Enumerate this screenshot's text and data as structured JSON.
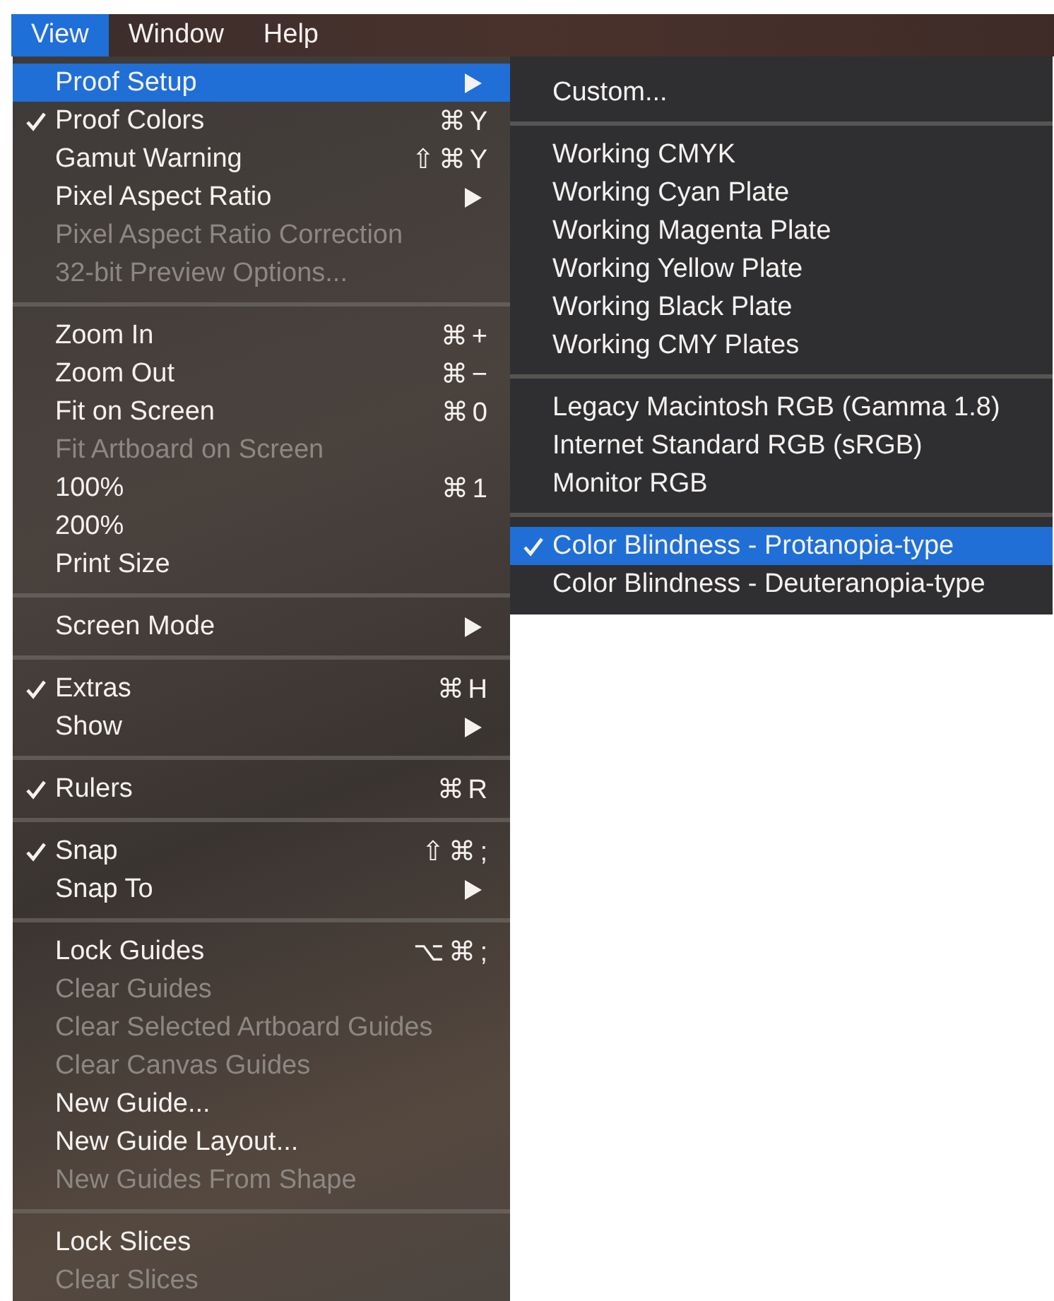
{
  "menu_bar": [
    {
      "label": "View",
      "selected": true
    },
    {
      "label": "Window",
      "selected": false
    },
    {
      "label": "Help",
      "selected": false
    }
  ],
  "view_menu": {
    "groups": [
      [
        {
          "label": "Proof Setup",
          "checked": false,
          "disabled": false,
          "selected": true,
          "has_submenu": true
        },
        {
          "label": "Proof Colors",
          "checked": true,
          "disabled": false,
          "selected": false,
          "shortcut": "⌘Y"
        },
        {
          "label": "Gamut Warning",
          "checked": false,
          "disabled": false,
          "selected": false,
          "shortcut": "⇧⌘Y"
        },
        {
          "label": "Pixel Aspect Ratio",
          "checked": false,
          "disabled": false,
          "selected": false,
          "has_submenu": true
        },
        {
          "label": "Pixel Aspect Ratio Correction",
          "checked": false,
          "disabled": true,
          "selected": false
        },
        {
          "label": "32-bit Preview Options...",
          "checked": false,
          "disabled": true,
          "selected": false
        }
      ],
      [
        {
          "label": "Zoom In",
          "checked": false,
          "disabled": false,
          "selected": false,
          "shortcut": "⌘+"
        },
        {
          "label": "Zoom Out",
          "checked": false,
          "disabled": false,
          "selected": false,
          "shortcut": "⌘−"
        },
        {
          "label": "Fit on Screen",
          "checked": false,
          "disabled": false,
          "selected": false,
          "shortcut": "⌘0"
        },
        {
          "label": "Fit Artboard on Screen",
          "checked": false,
          "disabled": true,
          "selected": false
        },
        {
          "label": "100%",
          "checked": false,
          "disabled": false,
          "selected": false,
          "shortcut": "⌘1"
        },
        {
          "label": "200%",
          "checked": false,
          "disabled": false,
          "selected": false
        },
        {
          "label": "Print Size",
          "checked": false,
          "disabled": false,
          "selected": false
        }
      ],
      [
        {
          "label": "Screen Mode",
          "checked": false,
          "disabled": false,
          "selected": false,
          "has_submenu": true
        }
      ],
      [
        {
          "label": "Extras",
          "checked": true,
          "disabled": false,
          "selected": false,
          "shortcut": "⌘H"
        },
        {
          "label": "Show",
          "checked": false,
          "disabled": false,
          "selected": false,
          "has_submenu": true
        }
      ],
      [
        {
          "label": "Rulers",
          "checked": true,
          "disabled": false,
          "selected": false,
          "shortcut": "⌘R"
        }
      ],
      [
        {
          "label": "Snap",
          "checked": true,
          "disabled": false,
          "selected": false,
          "shortcut": "⇧⌘;"
        },
        {
          "label": "Snap To",
          "checked": false,
          "disabled": false,
          "selected": false,
          "has_submenu": true
        }
      ],
      [
        {
          "label": "Lock Guides",
          "checked": false,
          "disabled": false,
          "selected": false,
          "shortcut": "⌥⌘;"
        },
        {
          "label": "Clear Guides",
          "checked": false,
          "disabled": true,
          "selected": false
        },
        {
          "label": "Clear Selected Artboard Guides",
          "checked": false,
          "disabled": true,
          "selected": false
        },
        {
          "label": "Clear Canvas Guides",
          "checked": false,
          "disabled": true,
          "selected": false
        },
        {
          "label": "New Guide...",
          "checked": false,
          "disabled": false,
          "selected": false
        },
        {
          "label": "New Guide Layout...",
          "checked": false,
          "disabled": false,
          "selected": false
        },
        {
          "label": "New Guides From Shape",
          "checked": false,
          "disabled": true,
          "selected": false
        }
      ],
      [
        {
          "label": "Lock Slices",
          "checked": false,
          "disabled": false,
          "selected": false
        },
        {
          "label": "Clear Slices",
          "checked": false,
          "disabled": true,
          "selected": false
        }
      ]
    ]
  },
  "proof_setup_submenu": {
    "groups": [
      [
        {
          "label": "Custom...",
          "checked": false,
          "disabled": false,
          "selected": false
        }
      ],
      [
        {
          "label": "Working CMYK",
          "checked": false,
          "disabled": false,
          "selected": false
        },
        {
          "label": "Working Cyan Plate",
          "checked": false,
          "disabled": false,
          "selected": false
        },
        {
          "label": "Working Magenta Plate",
          "checked": false,
          "disabled": false,
          "selected": false
        },
        {
          "label": "Working Yellow Plate",
          "checked": false,
          "disabled": false,
          "selected": false
        },
        {
          "label": "Working Black Plate",
          "checked": false,
          "disabled": false,
          "selected": false
        },
        {
          "label": "Working CMY Plates",
          "checked": false,
          "disabled": false,
          "selected": false
        }
      ],
      [
        {
          "label": "Legacy Macintosh RGB (Gamma 1.8)",
          "checked": false,
          "disabled": false,
          "selected": false
        },
        {
          "label": "Internet Standard RGB (sRGB)",
          "checked": false,
          "disabled": false,
          "selected": false
        },
        {
          "label": "Monitor RGB",
          "checked": false,
          "disabled": false,
          "selected": false
        }
      ],
      [
        {
          "label": "Color Blindness - Protanopia-type",
          "checked": true,
          "disabled": false,
          "selected": true
        },
        {
          "label": "Color Blindness - Deuteranopia-type",
          "checked": false,
          "disabled": false,
          "selected": false
        }
      ]
    ]
  }
}
